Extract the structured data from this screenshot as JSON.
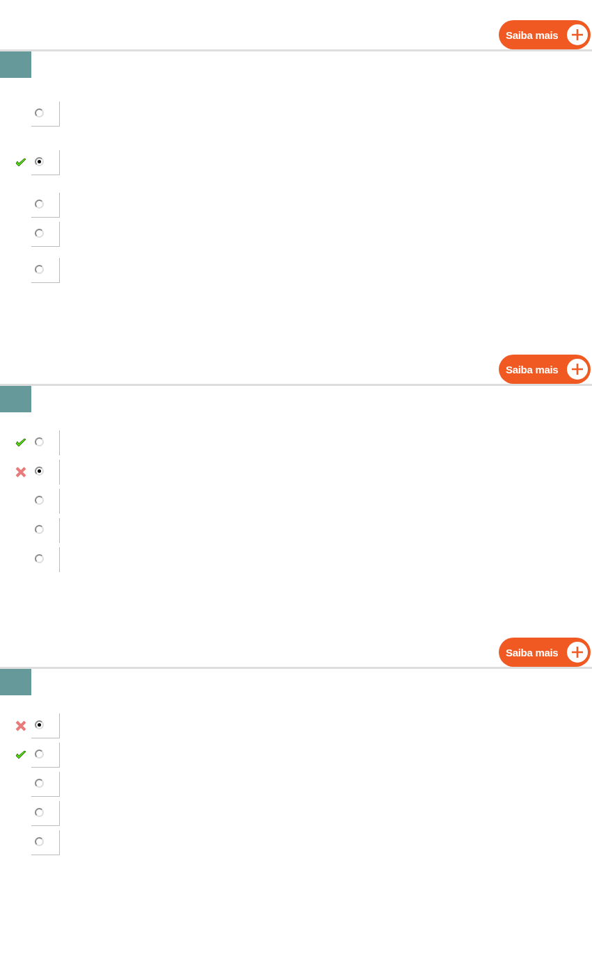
{
  "questions": [
    {
      "button": "Saiba mais",
      "options": [
        {
          "kind": "plain",
          "selected": false
        },
        {
          "kind": "correct",
          "selected": true
        },
        {
          "kind": "plain",
          "selected": false
        },
        {
          "kind": "plain",
          "selected": false
        },
        {
          "kind": "plain",
          "selected": false
        }
      ]
    },
    {
      "button": "Saiba mais",
      "options": [
        {
          "kind": "correct",
          "selected": false
        },
        {
          "kind": "wrong",
          "selected": true
        },
        {
          "kind": "plain",
          "selected": false
        },
        {
          "kind": "plain",
          "selected": false
        },
        {
          "kind": "plain",
          "selected": false
        }
      ]
    },
    {
      "button": "Saiba mais",
      "options": [
        {
          "kind": "wrong",
          "selected": true
        },
        {
          "kind": "correct",
          "selected": false
        },
        {
          "kind": "plain",
          "selected": false
        },
        {
          "kind": "plain",
          "selected": false
        },
        {
          "kind": "plain",
          "selected": false
        }
      ]
    }
  ]
}
